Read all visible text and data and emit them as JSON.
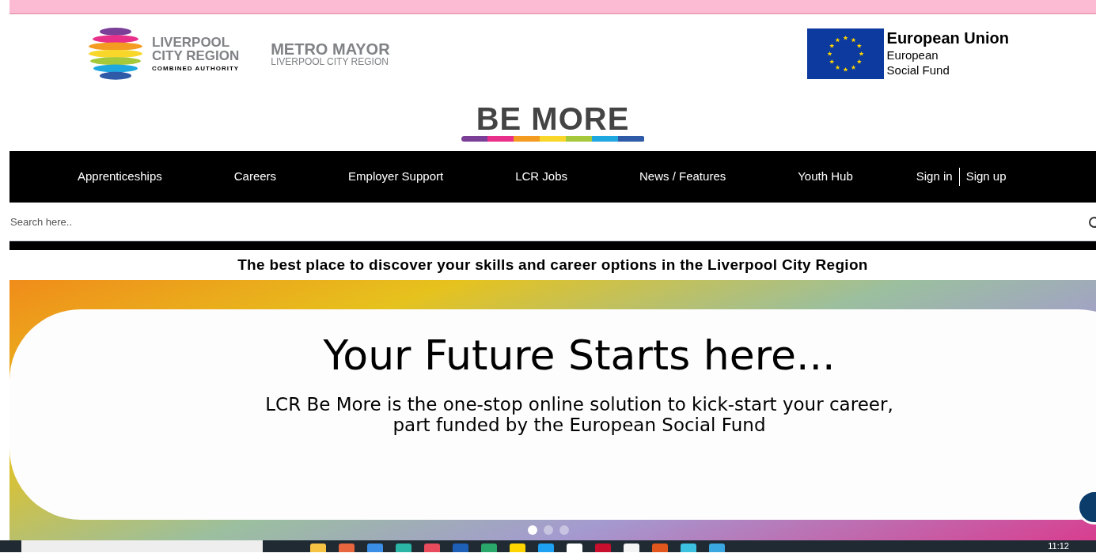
{
  "header": {
    "lcr_logo": {
      "line_1": "LIVERPOOL",
      "line_2": "CITY REGION",
      "line_3": "COMBINED AUTHORITY"
    },
    "mayor_logo": {
      "line_1": "METRO MAYOR",
      "line_2": "LIVERPOOL CITY REGION"
    },
    "eu_logo": {
      "title": "European Union",
      "line_1": "European",
      "line_2": "Social Fund"
    },
    "brand": "BE MORE"
  },
  "nav": {
    "items": [
      {
        "label": "Apprenticeships"
      },
      {
        "label": "Careers"
      },
      {
        "label": "Employer Support"
      },
      {
        "label": "LCR Jobs"
      },
      {
        "label": "News / Features"
      },
      {
        "label": "Youth Hub"
      }
    ],
    "sign_in": "Sign in",
    "sign_up": "Sign up"
  },
  "search": {
    "placeholder": "Search here.."
  },
  "tagline": "The best place to discover your skills and career options in the Liverpool City Region",
  "hero": {
    "title": "Your Future Starts here...",
    "subtitle_1": "LCR Be More is the one-stop online solution to kick-start your career,",
    "subtitle_2": "part funded by the European Social Fund",
    "dots": [
      {
        "selected": true
      },
      {
        "selected": false
      },
      {
        "selected": false
      }
    ]
  },
  "taskbar": {
    "clock": "11:12"
  }
}
